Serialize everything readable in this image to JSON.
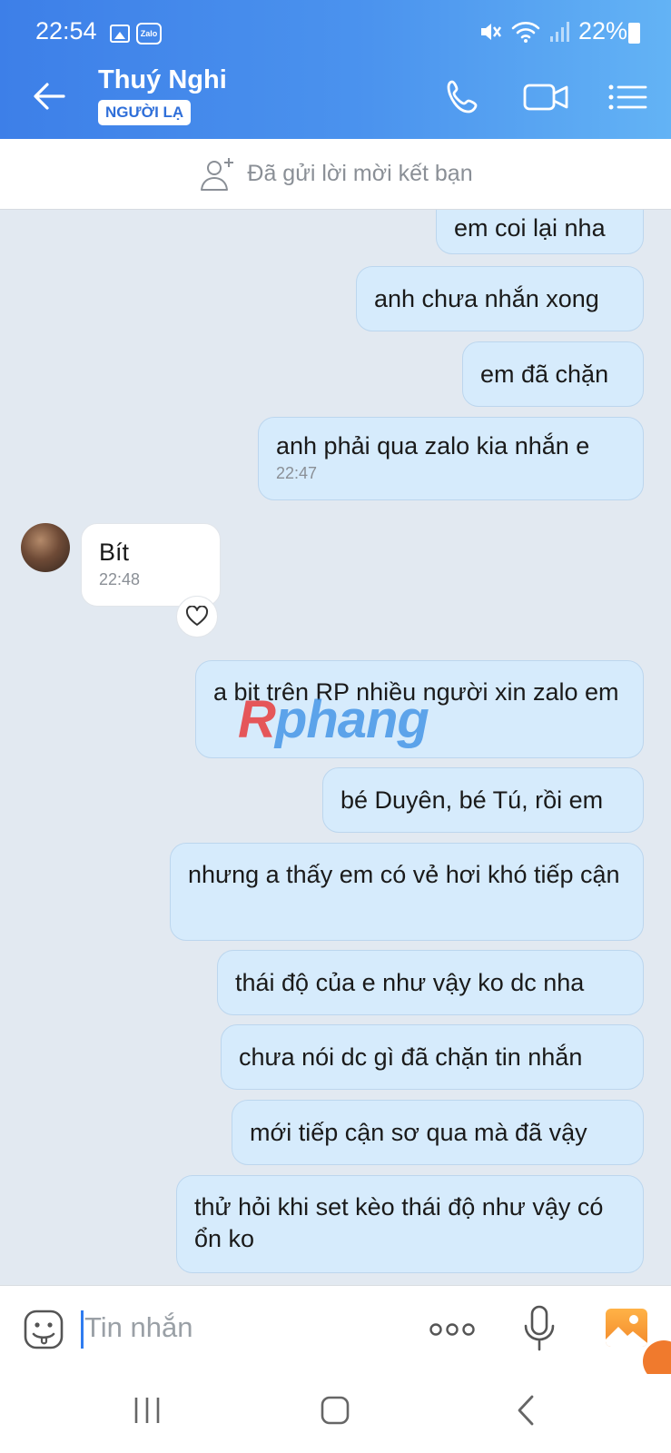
{
  "status_bar": {
    "time": "22:54",
    "notif_icons": [
      "photo-icon",
      "zalo-icon"
    ],
    "zalo_label": "Zalo",
    "battery": "22%"
  },
  "header": {
    "contact_name": "Thuý Nghi",
    "badge": "NGƯỜI LẠ",
    "actions": [
      "phone-icon",
      "video-call-icon",
      "menu-icon"
    ]
  },
  "friend_request": {
    "text": "Đã gửi lời mời kết bạn"
  },
  "messages": [
    {
      "dir": "out",
      "text": "em coi lại nha"
    },
    {
      "dir": "out",
      "text": "anh chưa nhắn xong"
    },
    {
      "dir": "out",
      "text": "em đã chặn"
    },
    {
      "dir": "out",
      "text": "anh phải qua zalo kia nhắn e",
      "time": "22:47"
    },
    {
      "dir": "in",
      "text": "Bít",
      "time": "22:48"
    },
    {
      "dir": "out",
      "text": "a bit trên RP nhiều người xin zalo em"
    },
    {
      "dir": "out",
      "text": "bé Duyên, bé Tú, rồi em"
    },
    {
      "dir": "out",
      "text": "nhưng a thấy em có vẻ hơi khó tiếp cận"
    },
    {
      "dir": "out",
      "text": "thái độ của e như vậy ko dc nha"
    },
    {
      "dir": "out",
      "text": "chưa nói dc gì đã chặn tin nhắn"
    },
    {
      "dir": "out",
      "text": "mới tiếp cận sơ qua mà đã vậy"
    },
    {
      "dir": "out",
      "text": "thử hỏi khi set kèo thái độ như vậy có ổn ko"
    }
  ],
  "watermark": {
    "first": "R",
    "rest": "phang"
  },
  "composer": {
    "placeholder": "Tin nhắn"
  },
  "colors": {
    "header_start": "#3d7fe8",
    "header_end": "#63b3f5",
    "outgoing_bubble": "#d6ebfc",
    "incoming_bubble": "#ffffff",
    "chat_background": "#e2e9f1"
  }
}
